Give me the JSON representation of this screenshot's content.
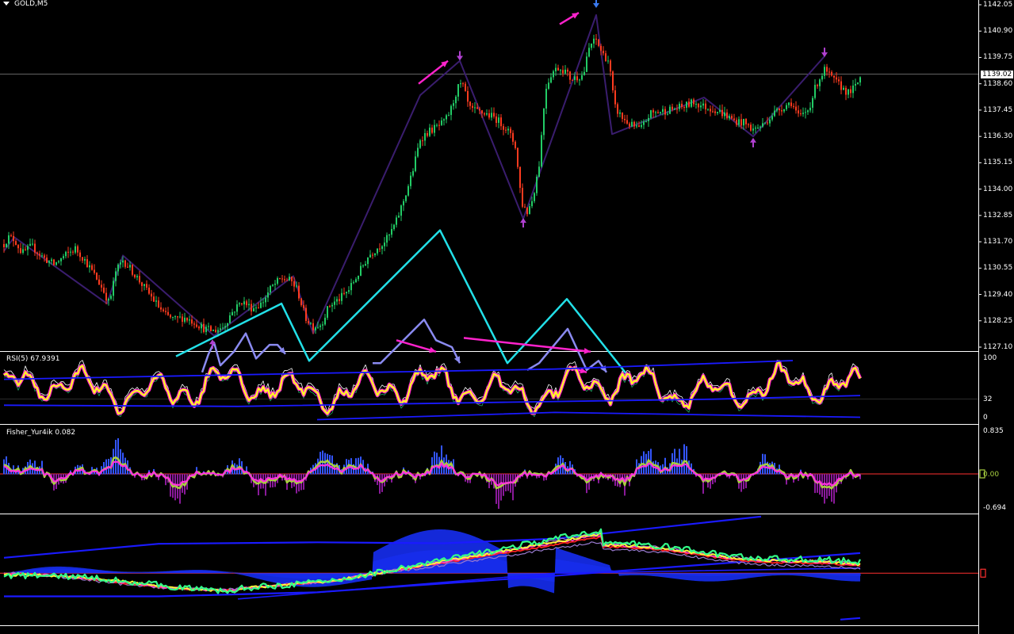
{
  "symbol_title": "GOLD,M5",
  "colors": {
    "background": "#000000",
    "grid": "#ffffff",
    "bull": "#22cc66",
    "bear": "#ff3b1f",
    "zigzag": "#3a1d6e",
    "cyan": "#22e0e8",
    "lilac": "#8a8af0",
    "magenta": "#ff22cc",
    "rsi": "#ffff22",
    "fisher": "#ff33dd",
    "fisher_signal": "#a8d040",
    "blue": "#1a1aff"
  },
  "main_panel": {
    "current_price": "1139.02",
    "price_ticks": [
      "1142.05",
      "1140.90",
      "1139.75",
      "1138.60",
      "1137.45",
      "1136.30",
      "1135.15",
      "1134.00",
      "1132.85",
      "1131.70",
      "1130.55",
      "1129.40",
      "1128.25",
      "1127.10"
    ]
  },
  "rsi_panel": {
    "title": "RSI(5) 67.9391",
    "levels": [
      "100",
      "32",
      "0"
    ]
  },
  "fisher_panel": {
    "title": "Fisher_Yur4ik 0.082",
    "levels": [
      "0.835",
      "0.00",
      "-0.694"
    ]
  },
  "chart_data": [
    {
      "type": "candlestick",
      "title": "GOLD,M5",
      "ylim": [
        1127.1,
        1142.05
      ],
      "y_ticks": [
        1142.05,
        1140.9,
        1139.75,
        1138.6,
        1137.45,
        1136.3,
        1135.15,
        1134.0,
        1132.85,
        1131.7,
        1130.55,
        1129.4,
        1128.25,
        1127.1
      ],
      "current_price": 1139.02,
      "close_path": [
        [
          0,
          1131.3
        ],
        [
          10,
          1131.9
        ],
        [
          18,
          1131.8
        ],
        [
          28,
          1131.2
        ],
        [
          40,
          1131.5
        ],
        [
          55,
          1131.0
        ],
        [
          68,
          1130.7
        ],
        [
          82,
          1131.1
        ],
        [
          95,
          1131.4
        ],
        [
          105,
          1131.0
        ],
        [
          120,
          1130.2
        ],
        [
          130,
          1129.6
        ],
        [
          138,
          1129.0
        ],
        [
          146,
          1130.4
        ],
        [
          155,
          1130.9
        ],
        [
          165,
          1130.5
        ],
        [
          180,
          1129.8
        ],
        [
          195,
          1129.1
        ],
        [
          208,
          1128.5
        ],
        [
          220,
          1128.3
        ],
        [
          232,
          1128.4
        ],
        [
          245,
          1128.2
        ],
        [
          258,
          1127.9
        ],
        [
          270,
          1127.8
        ],
        [
          282,
          1128.0
        ],
        [
          292,
          1128.6
        ],
        [
          305,
          1129.1
        ],
        [
          318,
          1128.8
        ],
        [
          330,
          1129.0
        ],
        [
          342,
          1129.7
        ],
        [
          355,
          1130.1
        ],
        [
          367,
          1130.0
        ],
        [
          375,
          1129.6
        ],
        [
          385,
          1128.4
        ],
        [
          395,
          1128.0
        ],
        [
          405,
          1128.1
        ],
        [
          415,
          1128.9
        ],
        [
          428,
          1129.2
        ],
        [
          440,
          1129.6
        ],
        [
          452,
          1130.3
        ],
        [
          465,
          1131.1
        ],
        [
          478,
          1131.5
        ],
        [
          490,
          1131.9
        ],
        [
          500,
          1132.6
        ],
        [
          510,
          1133.6
        ],
        [
          520,
          1134.7
        ],
        [
          530,
          1136.2
        ],
        [
          540,
          1136.5
        ],
        [
          550,
          1136.7
        ],
        [
          560,
          1136.9
        ],
        [
          568,
          1137.4
        ],
        [
          577,
          1138.4
        ],
        [
          583,
          1138.6
        ],
        [
          592,
          1137.5
        ],
        [
          600,
          1137.4
        ],
        [
          612,
          1137.3
        ],
        [
          625,
          1137.1
        ],
        [
          640,
          1136.6
        ],
        [
          650,
          1135.9
        ],
        [
          658,
          1133.4
        ],
        [
          665,
          1133.0
        ],
        [
          672,
          1133.6
        ],
        [
          680,
          1135.1
        ],
        [
          688,
          1138.4
        ],
        [
          696,
          1139.1
        ],
        [
          704,
          1139.3
        ],
        [
          712,
          1139.2
        ],
        [
          720,
          1138.8
        ],
        [
          728,
          1138.9
        ],
        [
          736,
          1139.0
        ],
        [
          744,
          1140.3
        ],
        [
          752,
          1140.5
        ],
        [
          760,
          1139.9
        ],
        [
          768,
          1139.6
        ],
        [
          775,
          1137.6
        ],
        [
          785,
          1137.1
        ],
        [
          795,
          1136.8
        ],
        [
          808,
          1136.6
        ],
        [
          820,
          1137.3
        ],
        [
          835,
          1137.4
        ],
        [
          850,
          1137.5
        ],
        [
          862,
          1137.6
        ],
        [
          875,
          1137.8
        ],
        [
          888,
          1137.6
        ],
        [
          900,
          1137.5
        ],
        [
          912,
          1137.3
        ],
        [
          925,
          1137.0
        ],
        [
          938,
          1136.9
        ],
        [
          950,
          1136.6
        ],
        [
          962,
          1136.8
        ],
        [
          975,
          1137.3
        ],
        [
          988,
          1137.6
        ],
        [
          998,
          1137.8
        ],
        [
          1008,
          1137.1
        ],
        [
          1020,
          1137.5
        ],
        [
          1030,
          1138.6
        ],
        [
          1040,
          1139.2
        ],
        [
          1050,
          1138.8
        ],
        [
          1060,
          1138.5
        ],
        [
          1070,
          1138.2
        ],
        [
          1080,
          1138.5
        ],
        [
          1085,
          1138.9
        ]
      ],
      "zigzag": [
        [
          5,
          1131.3
        ],
        [
          18,
          1131.9
        ],
        [
          135,
          1129.0
        ],
        [
          155,
          1131.1
        ],
        [
          270,
          1127.6
        ],
        [
          370,
          1130.2
        ],
        [
          395,
          1127.7
        ],
        [
          530,
          1138.1
        ],
        [
          580,
          1139.6
        ],
        [
          660,
          1132.7
        ],
        [
          752,
          1141.6
        ],
        [
          772,
          1136.4
        ],
        [
          888,
          1138.0
        ],
        [
          950,
          1136.3
        ],
        [
          1040,
          1139.8
        ]
      ],
      "wave_cyan": [
        [
          222,
          1126.7
        ],
        [
          355,
          1129.0
        ],
        [
          390,
          1126.5
        ],
        [
          555,
          1132.2
        ],
        [
          640,
          1126.4
        ],
        [
          715,
          1129.2
        ],
        [
          800,
          1125.5
        ]
      ],
      "wave_lilac": [
        [
          [
            255,
            1126.0
          ],
          [
            263,
            1126.8
          ],
          [
            270,
            1127.3
          ],
          [
            278,
            1126.3
          ],
          [
            295,
            1126.9
          ],
          [
            310,
            1127.7
          ],
          [
            323,
            1126.6
          ],
          [
            340,
            1127.2
          ],
          [
            350,
            1127.2
          ],
          [
            360,
            1126.8
          ]
        ],
        [
          [
            470,
            1126.4
          ],
          [
            480,
            1126.4
          ],
          [
            535,
            1128.3
          ],
          [
            550,
            1127.4
          ],
          [
            570,
            1127.1
          ],
          [
            580,
            1126.4
          ]
        ],
        [
          [
            665,
            1126.1
          ],
          [
            680,
            1126.4
          ],
          [
            716,
            1127.9
          ],
          [
            740,
            1126.1
          ],
          [
            755,
            1126.5
          ],
          [
            765,
            1126.0
          ]
        ]
      ],
      "wave_magenta": [
        [
          [
            528,
            1138.6
          ],
          [
            565,
            1139.6
          ]
        ],
        [
          [
            706,
            1141.2
          ],
          [
            730,
            1141.7
          ]
        ],
        [
          [
            500,
            1127.4
          ],
          [
            550,
            1126.9
          ]
        ],
        [
          [
            585,
            1127.5
          ],
          [
            745,
            1126.9
          ]
        ],
        [
          [
            720,
            1126.2
          ],
          [
            740,
            1126.0
          ]
        ]
      ],
      "fractal_arrows_down": [
        [
          580,
          1139.75
        ],
        [
          752,
          1142.05
        ],
        [
          1040,
          1139.9
        ]
      ],
      "fractal_arrows_up": [
        [
          660,
          1132.6
        ],
        [
          268,
          1127.3
        ],
        [
          950,
          1136.1
        ]
      ]
    },
    {
      "type": "line",
      "title": "RSI(5) 67.9391",
      "ylim": [
        0,
        100
      ],
      "y_ticks": [
        100,
        32,
        0
      ],
      "value": 67.9391
    },
    {
      "type": "bar",
      "title": "Fisher_Yur4ik 0.082",
      "ylim": [
        -0.694,
        0.835
      ],
      "y_ticks": [
        0.835,
        0.0,
        -0.694
      ],
      "value": 0.082
    },
    {
      "type": "area",
      "title": "",
      "ylim": [
        -1,
        1
      ]
    }
  ]
}
